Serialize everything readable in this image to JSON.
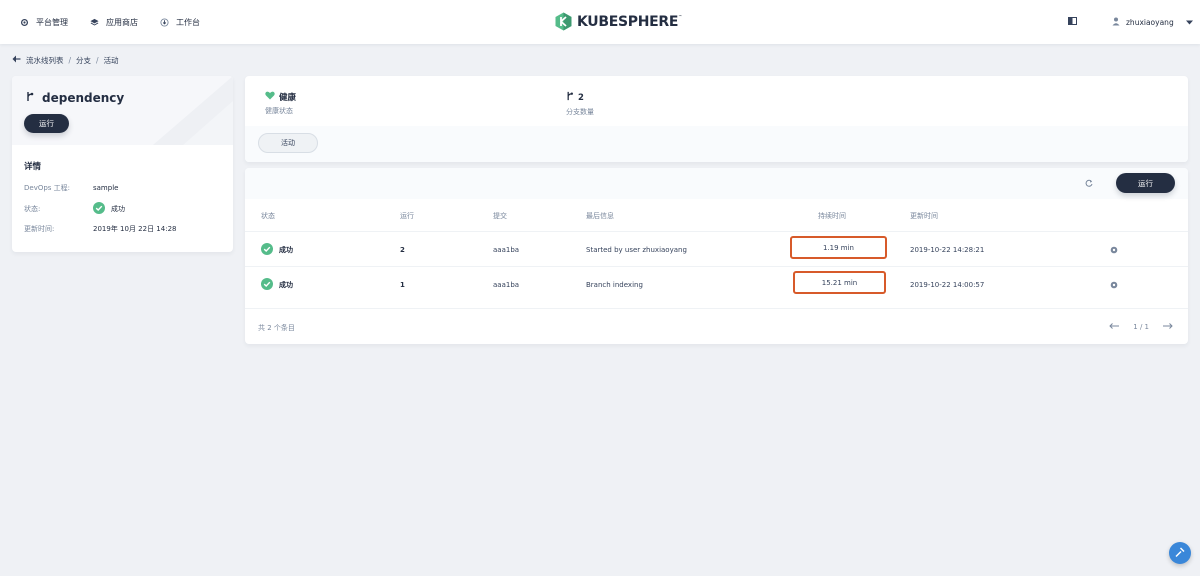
{
  "nav": {
    "items": [
      {
        "label": "平台管理",
        "icon": "gear-icon"
      },
      {
        "label": "应用商店",
        "icon": "layers-icon"
      },
      {
        "label": "工作台",
        "icon": "workbench-icon"
      }
    ],
    "logo_text": "KUBESPHERE",
    "logo_mark": "™",
    "user": "zhuxiaoyang"
  },
  "breadcrumb": [
    "流水线列表",
    "分支",
    "活动"
  ],
  "branch": {
    "name": "dependency",
    "run_label": "运行",
    "details_title": "详情",
    "details": [
      {
        "key": "DevOps 工程:",
        "value": "sample"
      },
      {
        "key": "状态:",
        "value": "成功"
      },
      {
        "key": "更新时间:",
        "value": "2019年 10月 22日 14:28"
      }
    ]
  },
  "summary": {
    "health_value": "健康",
    "health_label": "健康状态",
    "branch_count": "2",
    "branch_label": "分支数量",
    "tab_label": "活动"
  },
  "table": {
    "run_label": "运行",
    "headers": [
      "状态",
      "运行",
      "提交",
      "最后信息",
      "持续时间",
      "更新时间"
    ],
    "rows": [
      {
        "status": "成功",
        "run": "2",
        "commit": "aaa1ba",
        "message": "Started by user zhuxiaoyang",
        "duration": "1.19 min",
        "updated": "2019-10-22 14:28:21"
      },
      {
        "status": "成功",
        "run": "1",
        "commit": "aaa1ba",
        "message": "Branch indexing",
        "duration": "15.21 min",
        "updated": "2019-10-22 14:00:57"
      }
    ],
    "total": "共 2 个条目",
    "page": "1 / 1"
  },
  "colors": {
    "dark": "#242e42",
    "success": "#55bc8a",
    "highlight": "#d75a2a",
    "help": "#3a87d9"
  }
}
